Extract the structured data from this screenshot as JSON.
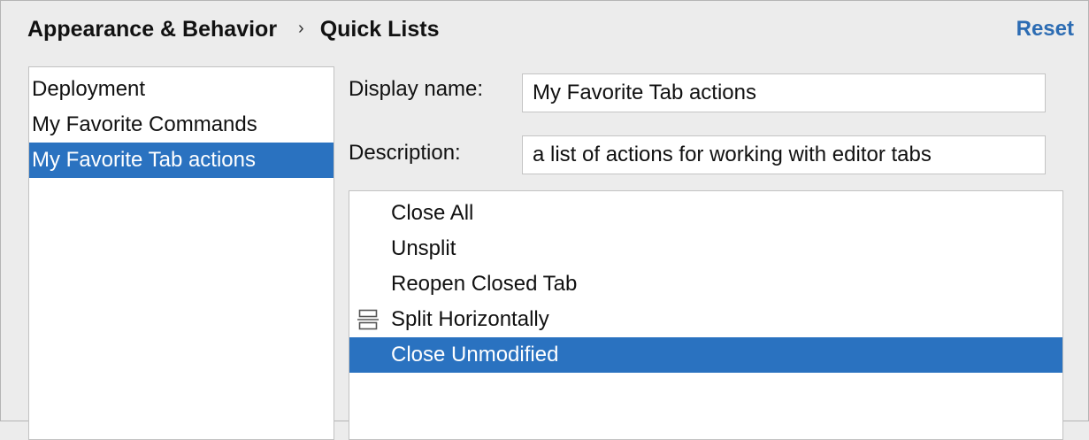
{
  "breadcrumb": {
    "parent": "Appearance & Behavior",
    "separator": "›",
    "current": "Quick Lists"
  },
  "reset_label": "Reset",
  "quick_lists": [
    {
      "label": "Deployment"
    },
    {
      "label": "My Favorite Commands"
    },
    {
      "label": "My Favorite Tab actions",
      "selected": true
    }
  ],
  "form": {
    "display_name_label": "Display name:",
    "display_name_value": "My Favorite Tab actions",
    "description_label": "Description:",
    "description_value": "a list of actions for working with editor tabs"
  },
  "actions": [
    {
      "label": "Close All"
    },
    {
      "label": "Unsplit"
    },
    {
      "label": "Reopen Closed Tab"
    },
    {
      "label": "Split Horizontally",
      "icon": "split-horizontally-icon"
    },
    {
      "label": "Close Unmodified",
      "selected": true
    }
  ],
  "colors": {
    "accent": "#2a72c0",
    "link": "#2c6cb3",
    "background": "#ececec"
  }
}
